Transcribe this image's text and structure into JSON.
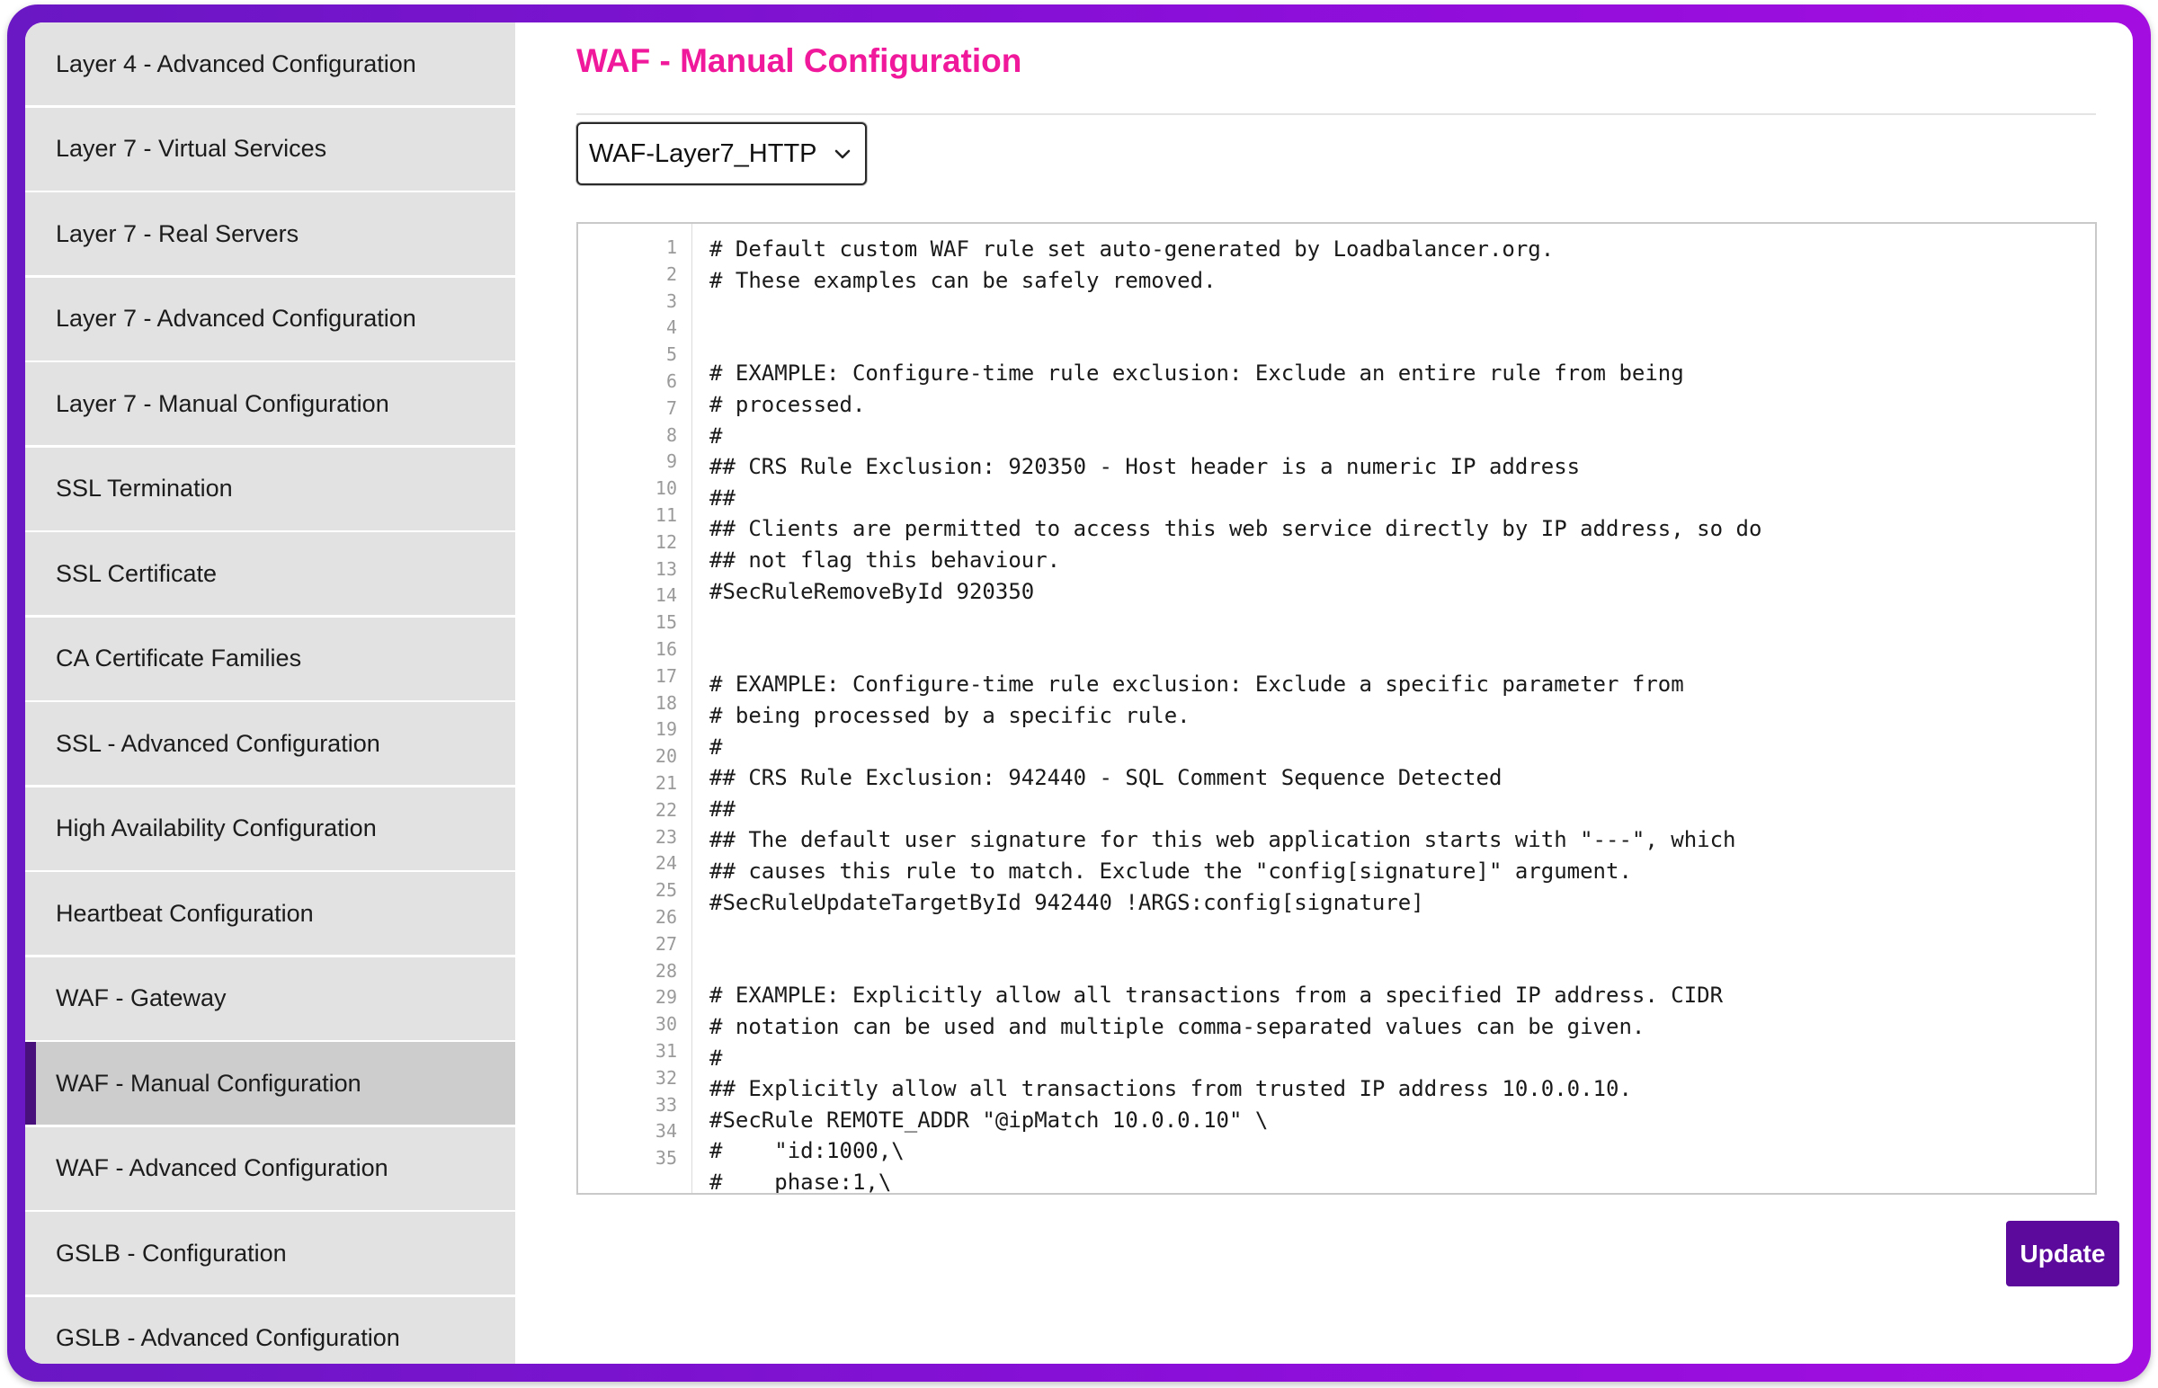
{
  "sidebar": {
    "items": [
      {
        "label": "Layer 4 - Advanced Configuration",
        "active": false
      },
      {
        "label": "Layer 7 - Virtual Services",
        "active": false
      },
      {
        "label": "Layer 7 - Real Servers",
        "active": false
      },
      {
        "label": "Layer 7 - Advanced Configuration",
        "active": false
      },
      {
        "label": "Layer 7 - Manual Configuration",
        "active": false
      },
      {
        "label": "SSL Termination",
        "active": false
      },
      {
        "label": "SSL Certificate",
        "active": false
      },
      {
        "label": "CA Certificate Families",
        "active": false
      },
      {
        "label": "SSL - Advanced Configuration",
        "active": false
      },
      {
        "label": "High Availability Configuration",
        "active": false
      },
      {
        "label": "Heartbeat Configuration",
        "active": false
      },
      {
        "label": "WAF - Gateway",
        "active": false
      },
      {
        "label": "WAF - Manual Configuration",
        "active": true
      },
      {
        "label": "WAF - Advanced Configuration",
        "active": false
      },
      {
        "label": "GSLB - Configuration",
        "active": false
      },
      {
        "label": "GSLB - Advanced Configuration",
        "active": false
      }
    ]
  },
  "main": {
    "title": "WAF - Manual Configuration",
    "select": {
      "value": "WAF-Layer7_HTTP"
    },
    "editor": {
      "line_numbers": [
        "1",
        "2",
        "3",
        "4",
        "5",
        "6",
        "7",
        "8",
        "9",
        "10",
        "11",
        "12",
        "13",
        "14",
        "15",
        "16",
        "17",
        "18",
        "19",
        "20",
        "21",
        "22",
        "23",
        "24",
        "25",
        "26",
        "27",
        "28",
        "29",
        "30",
        "31",
        "32",
        "33",
        "34",
        "35"
      ],
      "lines": [
        "# Default custom WAF rule set auto-generated by Loadbalancer.org.",
        "# These examples can be safely removed.",
        "",
        "",
        "# EXAMPLE: Configure-time rule exclusion: Exclude an entire rule from being",
        "# processed.",
        "#",
        "## CRS Rule Exclusion: 920350 - Host header is a numeric IP address",
        "##",
        "## Clients are permitted to access this web service directly by IP address, so do",
        "## not flag this behaviour.",
        "#SecRuleRemoveById 920350",
        "",
        "",
        "# EXAMPLE: Configure-time rule exclusion: Exclude a specific parameter from",
        "# being processed by a specific rule.",
        "#",
        "## CRS Rule Exclusion: 942440 - SQL Comment Sequence Detected",
        "##",
        "## The default user signature for this web application starts with \"---\", which",
        "## causes this rule to match. Exclude the \"config[signature]\" argument.",
        "#SecRuleUpdateTargetById 942440 !ARGS:config[signature]",
        "",
        "",
        "# EXAMPLE: Explicitly allow all transactions from a specified IP address. CIDR",
        "# notation can be used and multiple comma-separated values can be given.",
        "#",
        "## Explicitly allow all transactions from trusted IP address 10.0.0.10.",
        "#SecRule REMOTE_ADDR \"@ipMatch 10.0.0.10\" \\",
        "#    \"id:1000,\\",
        "#    phase:1,\\"
      ]
    },
    "update_label": "Update"
  },
  "colors": {
    "title": "#f0199b",
    "accent": "#5b0a9c",
    "active_marker": "#48107a",
    "frame": "#8a0fd8"
  }
}
